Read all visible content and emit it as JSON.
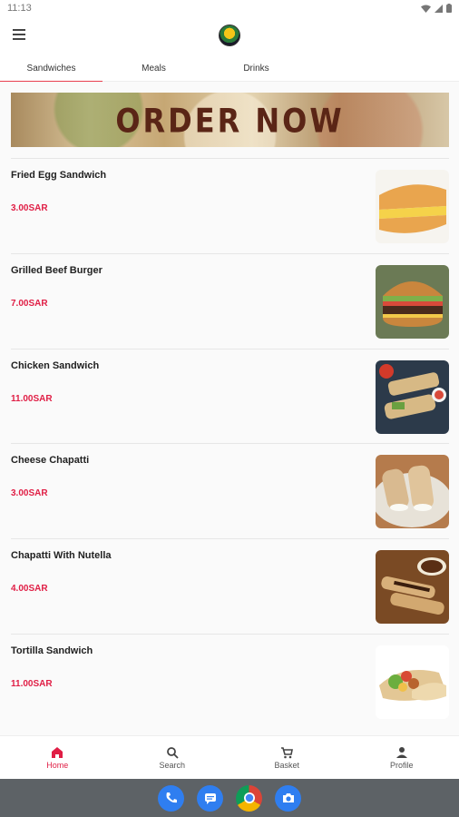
{
  "status": {
    "time": "11:13"
  },
  "tabs": [
    {
      "label": "Sandwiches",
      "active": true
    },
    {
      "label": "Meals",
      "active": false
    },
    {
      "label": "Drinks",
      "active": false
    }
  ],
  "banner": {
    "text": "ORDER NOW"
  },
  "products": [
    {
      "name": "Fried Egg Sandwich",
      "price": "3.00SAR"
    },
    {
      "name": "Grilled Beef Burger",
      "price": "7.00SAR"
    },
    {
      "name": "Chicken Sandwich",
      "price": "11.00SAR"
    },
    {
      "name": "Cheese Chapatti",
      "price": "3.00SAR"
    },
    {
      "name": "Chapatti With Nutella",
      "price": "4.00SAR"
    },
    {
      "name": "Tortilla Sandwich",
      "price": "11.00SAR"
    }
  ],
  "nav": [
    {
      "label": "Home",
      "icon": "home-icon",
      "active": true
    },
    {
      "label": "Search",
      "icon": "search-icon",
      "active": false
    },
    {
      "label": "Basket",
      "icon": "cart-icon",
      "active": false
    },
    {
      "label": "Profile",
      "icon": "person-icon",
      "active": false
    }
  ],
  "colors": {
    "accent": "#e01e45",
    "tab_indicator": "#e8404f",
    "system_bar": "#5d6266"
  }
}
